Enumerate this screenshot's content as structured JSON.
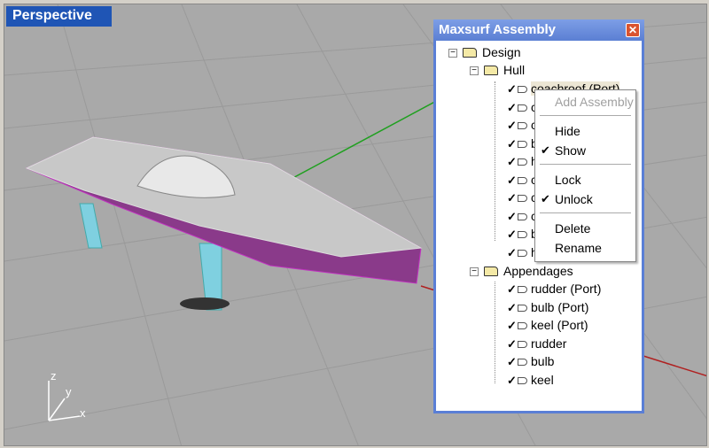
{
  "viewport": {
    "label": "Perspective",
    "axes": {
      "z": "z",
      "y": "y",
      "x": "x"
    }
  },
  "dialog": {
    "title": "Maxsurf Assembly",
    "close_icon": "close-icon",
    "tree": {
      "root": "Design",
      "hull": {
        "label": "Hull",
        "items": [
          "coachroof (Port)",
          "c",
          "c",
          "b",
          "h",
          "c",
          "c",
          "c",
          "b",
          "h"
        ]
      },
      "appendages": {
        "label": "Appendages",
        "items": [
          "rudder (Port)",
          "bulb (Port)",
          "keel (Port)",
          "rudder",
          "bulb",
          "keel"
        ]
      }
    }
  },
  "context_menu": {
    "items": [
      {
        "label": "Add Assembly",
        "disabled": true
      },
      {
        "label": "Hide"
      },
      {
        "label": "Show",
        "checked": true
      },
      {
        "label": "Lock"
      },
      {
        "label": "Unlock",
        "checked": true
      },
      {
        "label": "Delete"
      },
      {
        "label": "Rename"
      }
    ],
    "check": "✔"
  },
  "colors": {
    "title_bar": "#5b7fd3",
    "hull_trim": "#a020a0",
    "appendage": "#7fd0e0",
    "x_axis": "#b02020",
    "y_axis": "#20a020"
  }
}
